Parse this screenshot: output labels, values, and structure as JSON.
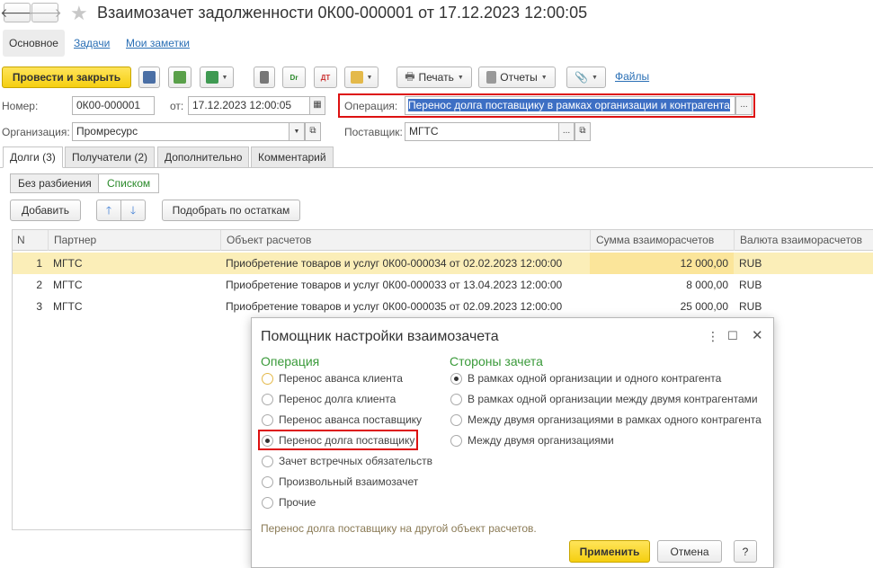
{
  "window": {
    "title": "Взаимозачет задолженности 0К00-000001 от 17.12.2023 12:00:05"
  },
  "main_tabs": {
    "basic": "Основное",
    "tasks": "Задачи",
    "notes": "Мои заметки"
  },
  "toolbar": {
    "post_close": "Провести и закрыть",
    "print": "Печать",
    "reports": "Отчеты",
    "files": "Файлы"
  },
  "form": {
    "number_label": "Номер:",
    "number_value": "0К00-000001",
    "date_label": "от:",
    "date_value": "17.12.2023 12:00:05",
    "operation_label": "Операция:",
    "operation_value": "Перенос долга поставщику в рамках организации и контрагента",
    "org_label": "Организация:",
    "org_value": "Промресурс",
    "supplier_label": "Поставщик:",
    "supplier_value": "МГТС"
  },
  "sub_tabs": [
    "Долги (3)",
    "Получатели (2)",
    "Дополнительно",
    "Комментарий"
  ],
  "view_toggle": {
    "no_split": "Без разбиения",
    "list": "Списком"
  },
  "actions": {
    "add": "Добавить",
    "pick_by_balance": "Подобрать по остаткам"
  },
  "table": {
    "columns": [
      "N",
      "Партнер",
      "Объект расчетов",
      "Сумма взаиморасчетов",
      "Валюта взаиморасчетов"
    ],
    "rows": [
      {
        "n": "1",
        "partner": "МГТС",
        "object": "Приобретение товаров и услуг 0К00-000034 от 02.02.2023 12:00:00",
        "sum": "12 000,00",
        "currency": "RUB"
      },
      {
        "n": "2",
        "partner": "МГТС",
        "object": "Приобретение товаров и услуг 0К00-000033 от 13.04.2023 12:00:00",
        "sum": "8 000,00",
        "currency": "RUB"
      },
      {
        "n": "3",
        "partner": "МГТС",
        "object": "Приобретение товаров и услуг 0К00-000035 от 02.09.2023 12:00:00",
        "sum": "25 000,00",
        "currency": "RUB"
      }
    ]
  },
  "dialog": {
    "title": "Помощник настройки взаимозачета",
    "operation_heading": "Операция",
    "operations": [
      "Перенос аванса клиента",
      "Перенос долга клиента",
      "Перенос аванса поставщику",
      "Перенос долга поставщику",
      "Зачет встречных обязательств",
      "Произвольный взаимозачет",
      "Прочие"
    ],
    "selected_operation": 3,
    "sides_heading": "Стороны зачета",
    "sides": [
      "В рамках одной организации и одного контрагента",
      "В рамках одной организации между двумя контрагентами",
      "Между двумя организациями в рамках одного контрагента",
      "Между двумя организациями"
    ],
    "selected_side": 0,
    "hint": "Перенос долга поставщику на другой объект расчетов.",
    "apply": "Применить",
    "cancel": "Отмена",
    "help": "?"
  }
}
